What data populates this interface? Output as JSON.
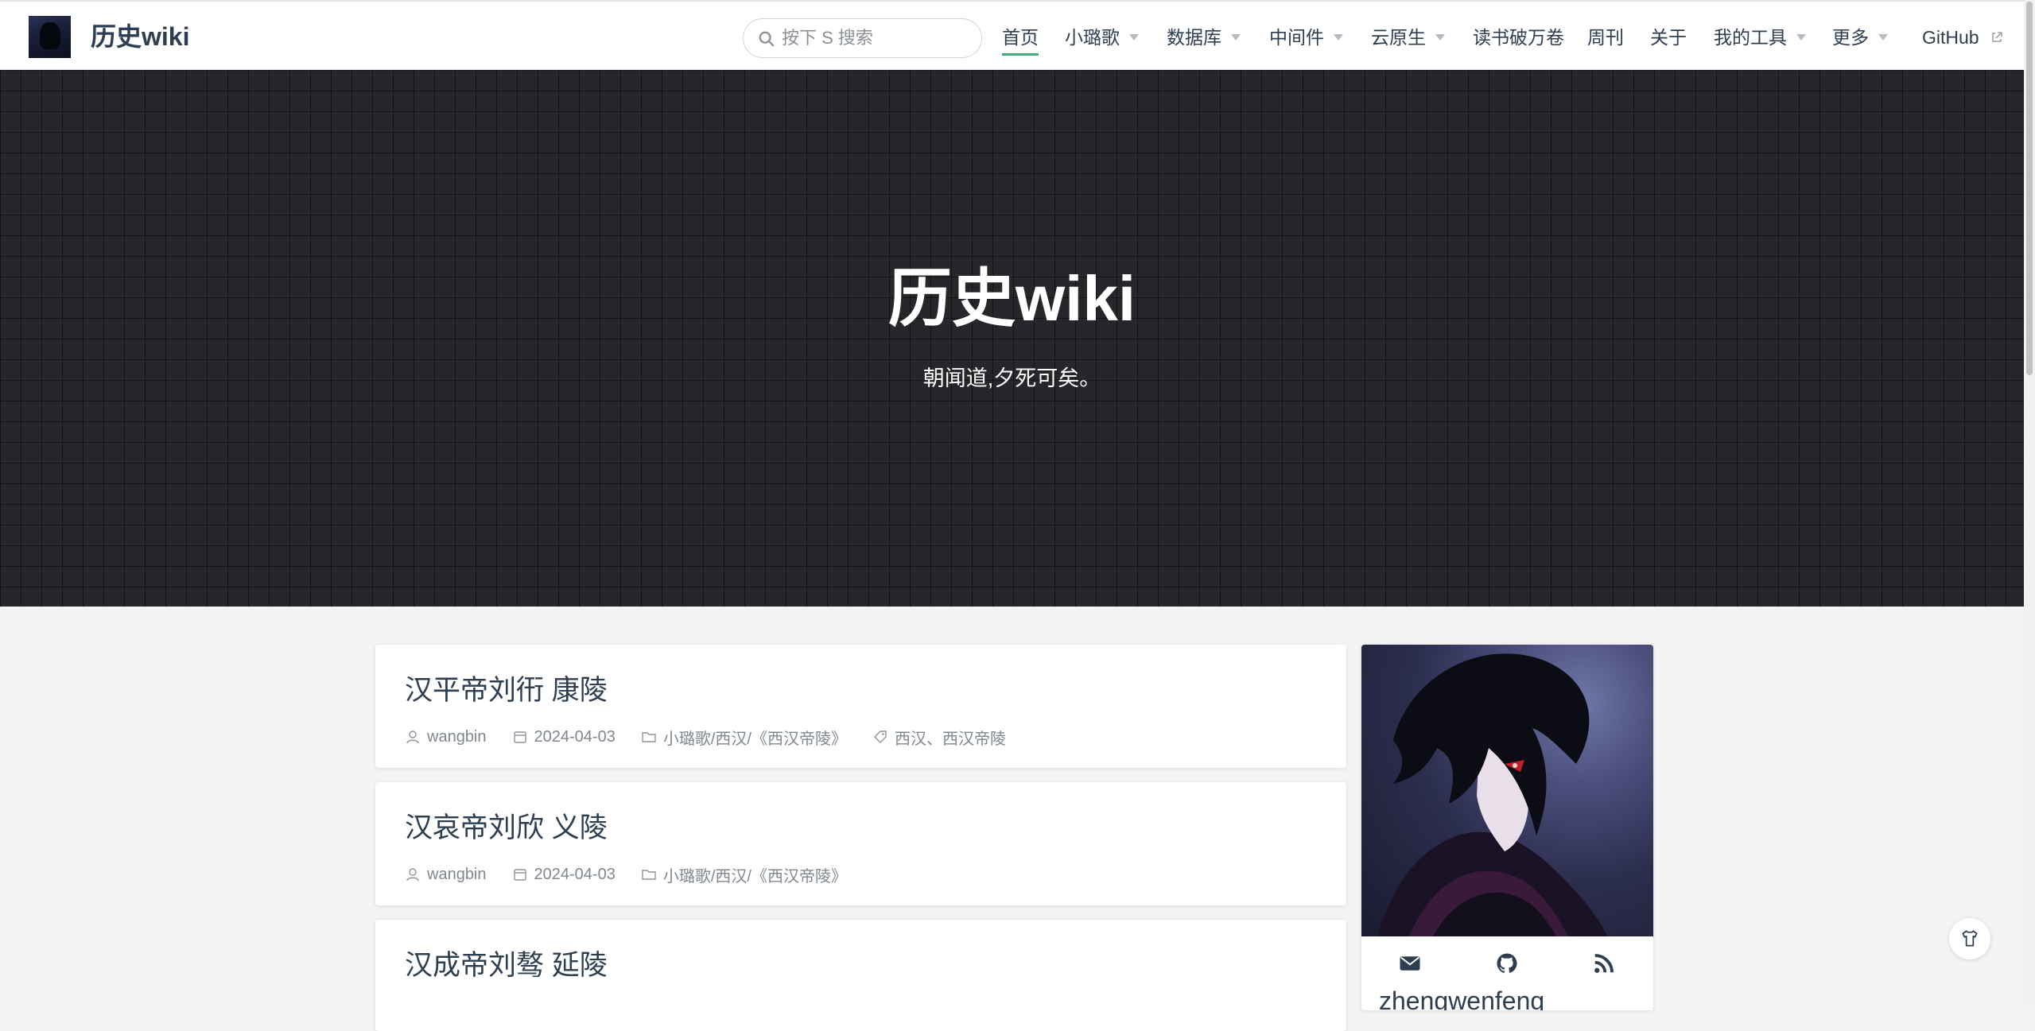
{
  "header": {
    "site_name": "历史wiki",
    "search_placeholder": "按下 S 搜索",
    "nav": [
      {
        "label": "首页",
        "active": true
      },
      {
        "label": "小璐歌",
        "dropdown": true
      },
      {
        "label": "数据库",
        "dropdown": true
      },
      {
        "label": "中间件",
        "dropdown": true
      },
      {
        "label": "云原生",
        "dropdown": true
      },
      {
        "label": "读书破万卷"
      },
      {
        "label": "周刊"
      },
      {
        "label": "关于"
      },
      {
        "label": "我的工具",
        "dropdown": true
      },
      {
        "label": "更多",
        "dropdown": true
      },
      {
        "label": "GitHub",
        "external": true
      }
    ]
  },
  "hero": {
    "title": "历史wiki",
    "subtitle": "朝闻道,夕死可矣。"
  },
  "posts": [
    {
      "title": "汉平帝刘衎 康陵",
      "author": "wangbin",
      "date": "2024-04-03",
      "category": "小璐歌/西汉/《西汉帝陵》",
      "tags": "西汉、西汉帝陵"
    },
    {
      "title": "汉哀帝刘欣 义陵",
      "author": "wangbin",
      "date": "2024-04-03",
      "category": "小璐歌/西汉/《西汉帝陵》",
      "tags": ""
    },
    {
      "title": "汉成帝刘骜 延陵",
      "author": "",
      "date": "",
      "category": "",
      "tags": ""
    }
  ],
  "sidebar": {
    "name": "zhengwenfeng",
    "social": [
      "mail-icon",
      "github-icon",
      "rss-icon"
    ]
  },
  "colors": {
    "accent": "#3eaf7c",
    "hero_bg": "#27272b",
    "text": "#2c3e50",
    "meta": "#7f8790"
  }
}
